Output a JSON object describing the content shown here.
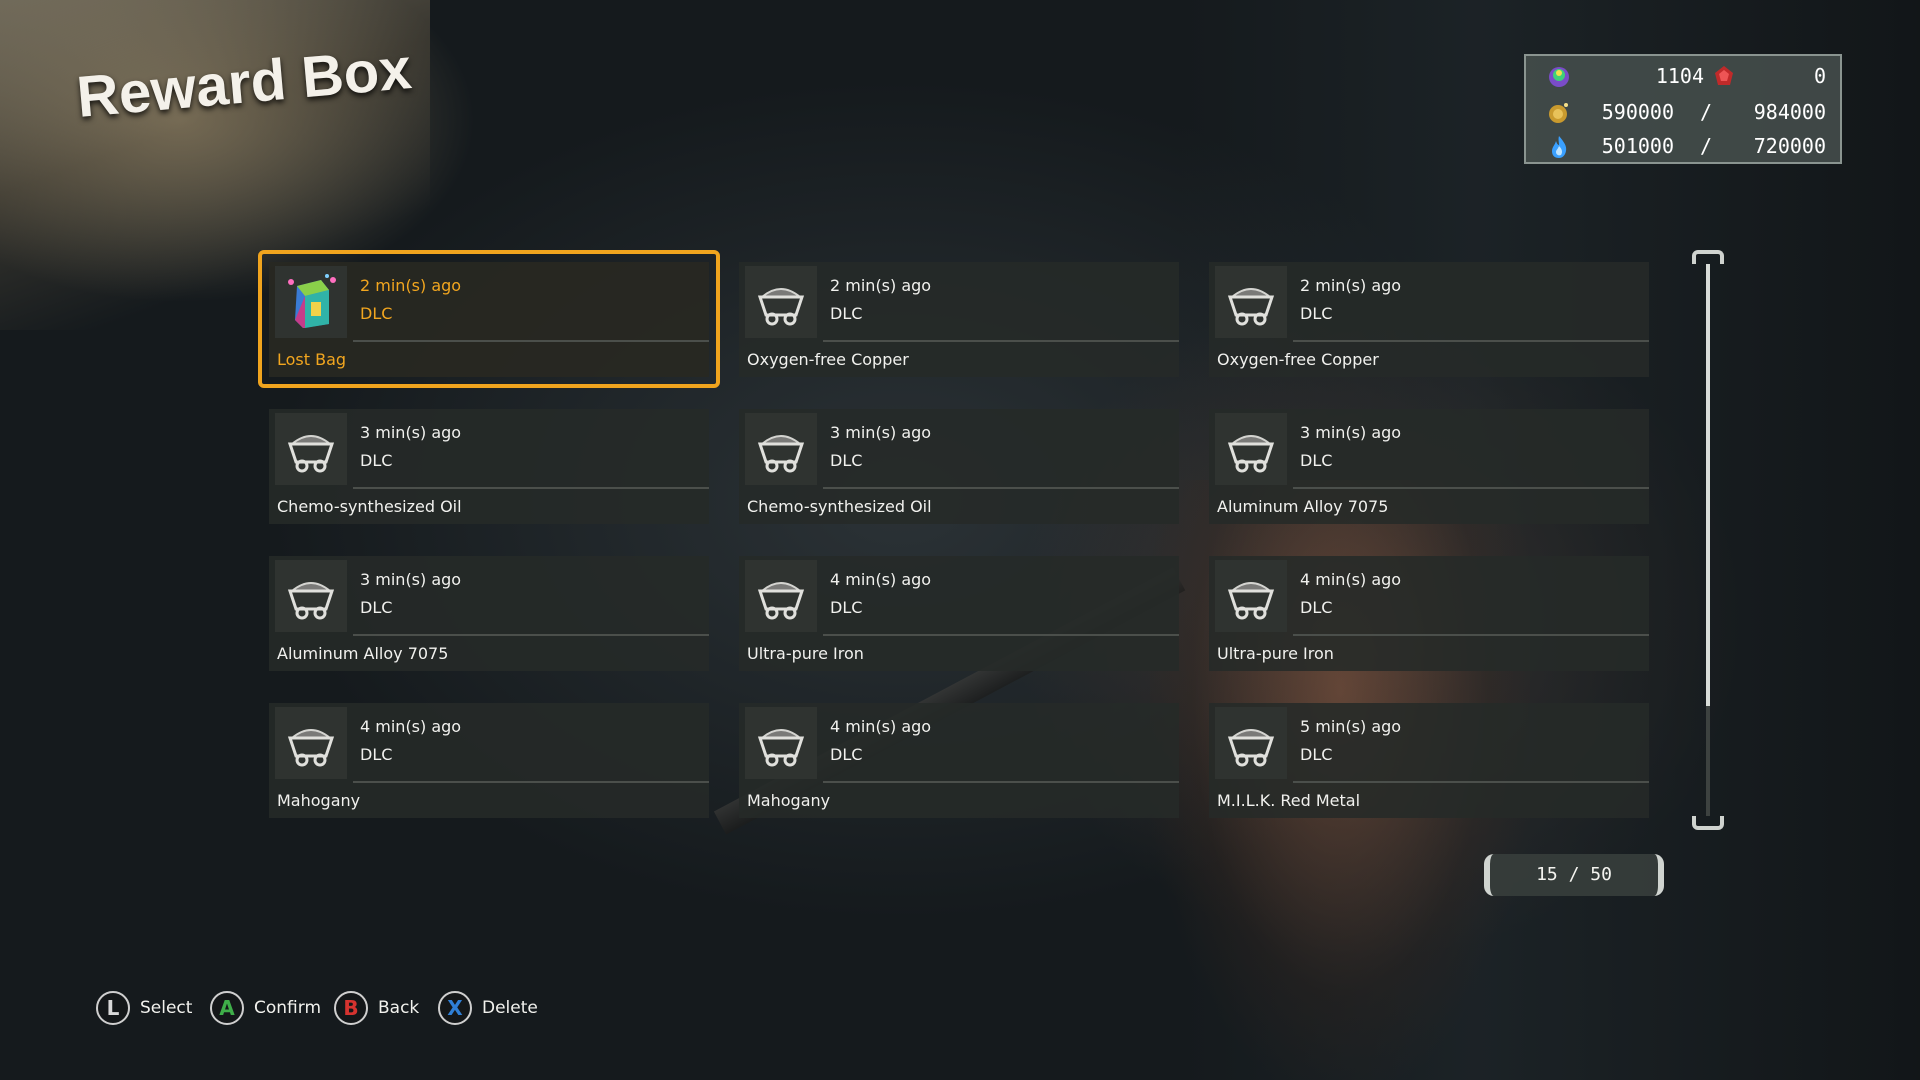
{
  "screen": {
    "title": "Reward Box"
  },
  "currency": {
    "row1": {
      "value": "1104",
      "value2": "0"
    },
    "row2": {
      "current": "590000",
      "max": "984000"
    },
    "row3": {
      "current": "501000",
      "max": "720000"
    },
    "separator": "/"
  },
  "rewards": [
    {
      "time": "2 min(s) ago",
      "source": "DLC",
      "name": "Lost Bag",
      "icon": "lost-bag-icon",
      "selected": true
    },
    {
      "time": "2 min(s) ago",
      "source": "DLC",
      "name": "Oxygen-free Copper",
      "icon": "mine-cart-icon"
    },
    {
      "time": "2 min(s) ago",
      "source": "DLC",
      "name": "Oxygen-free Copper",
      "icon": "mine-cart-icon"
    },
    {
      "time": "3 min(s) ago",
      "source": "DLC",
      "name": "Chemo-synthesized Oil",
      "icon": "mine-cart-icon"
    },
    {
      "time": "3 min(s) ago",
      "source": "DLC",
      "name": "Chemo-synthesized Oil",
      "icon": "mine-cart-icon"
    },
    {
      "time": "3 min(s) ago",
      "source": "DLC",
      "name": "Aluminum Alloy 7075",
      "icon": "mine-cart-icon"
    },
    {
      "time": "3 min(s) ago",
      "source": "DLC",
      "name": "Aluminum Alloy 7075",
      "icon": "mine-cart-icon"
    },
    {
      "time": "4 min(s) ago",
      "source": "DLC",
      "name": "Ultra-pure Iron",
      "icon": "mine-cart-icon"
    },
    {
      "time": "4 min(s) ago",
      "source": "DLC",
      "name": "Ultra-pure Iron",
      "icon": "mine-cart-icon"
    },
    {
      "time": "4 min(s) ago",
      "source": "DLC",
      "name": "Mahogany",
      "icon": "mine-cart-icon"
    },
    {
      "time": "4 min(s) ago",
      "source": "DLC",
      "name": "Mahogany",
      "icon": "mine-cart-icon"
    },
    {
      "time": "5 min(s) ago",
      "source": "DLC",
      "name": "M.I.L.K. Red Metal",
      "icon": "mine-cart-icon"
    }
  ],
  "scroll": {
    "position_fraction": 0.8
  },
  "pagination": {
    "text": "15 / 50"
  },
  "footer": {
    "select": {
      "key": "L",
      "label": "Select"
    },
    "confirm": {
      "key": "A",
      "label": "Confirm"
    },
    "back": {
      "key": "B",
      "label": "Back"
    },
    "delete": {
      "key": "X",
      "label": "Delete"
    }
  },
  "colors": {
    "selected_accent": "#f0a41e",
    "key_a": "#3fae49",
    "key_b": "#d6332f",
    "key_x": "#2f7fd6",
    "key_l": "#d8d8d8"
  }
}
